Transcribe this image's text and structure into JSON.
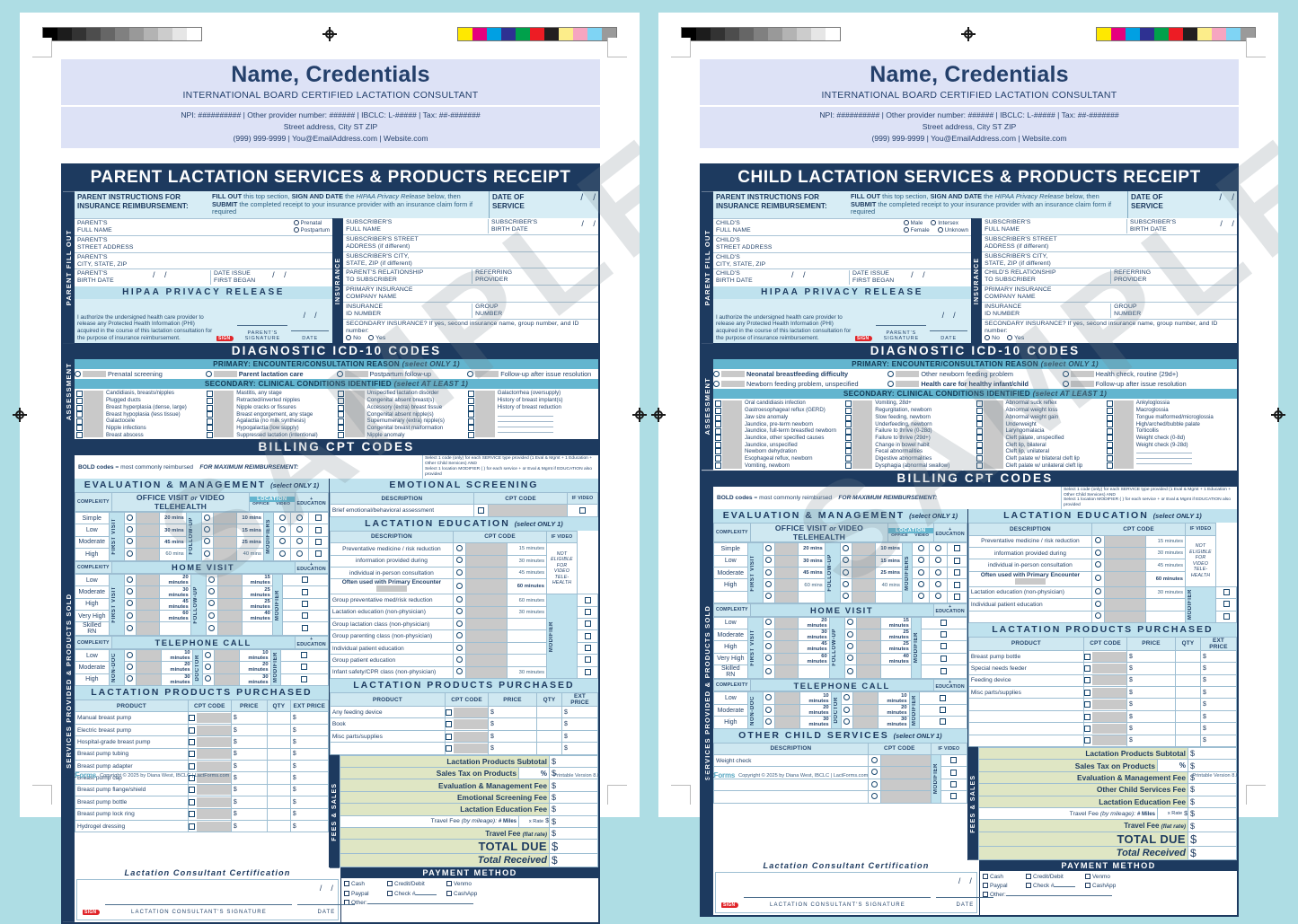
{
  "letterhead": {
    "name": "Name, Credentials",
    "subtitle": "INTERNATIONAL BOARD CERTIFIED LACTATION CONSULTANT",
    "line1": "NPI: ########## | Other provider number: ###### | IBCLC: L-##### | Tax: ##-#######",
    "line2": "Street address, City ST ZIP",
    "line3": "(999) 999-9999 | You@EmailAddress.com | Website.com"
  },
  "watermark": "SAMPLE",
  "common": {
    "tab_fillout": "PARENT FILL OUT",
    "tab_insurance": "INSURANCE",
    "tab_assessment": "ASSESSMENT",
    "tab_services": "SERVICES PROVIDED & PRODUCTS SOLD",
    "tab_fees": "FEES & SALES",
    "instructions_label": "PARENT INSTRUCTIONS FOR INSURANCE REIMBURSEMENT:",
    "instructions_text_a": "FILL OUT",
    "instructions_text_b": " this top section, ",
    "instructions_text_c": "SIGN AND DATE",
    "instructions_text_d": " the ",
    "instructions_text_e": "HIPAA Privacy Release",
    "instructions_text_f": " below, then ",
    "instructions_text_g": "SUBMIT",
    "instructions_text_h": " the completed receipt to your insurance provider with an insurance claim form if required",
    "date_of_service": "DATE OF SERVICE",
    "subscriber_full_name": "SUBSCRIBER'S FULL NAME",
    "subscriber_birth_date": "SUBSCRIBER'S BIRTH DATE",
    "subscriber_street": "SUBSCRIBER'S STREET ADDRESS (if different)",
    "subscriber_city": "SUBSCRIBER'S CITY, STATE, ZIP (if different)",
    "referring_provider": "REFERRING PROVIDER",
    "primary_insurance": "PRIMARY INSURANCE COMPANY NAME",
    "insurance_id": "INSURANCE ID NUMBER",
    "group_number": "GROUP NUMBER",
    "secondary_insurance": "SECONDARY INSURANCE?  If yes, second insurance name, group number, and ID number:",
    "opt_no": "No",
    "opt_yes": "Yes",
    "hipaa_title": "HIPAA PRIVACY RELEASE",
    "hipaa_text": "I authorize the undersigned health care provider to release any Protected Health Information (PHI) acquired in the course of this lactation consultation for the purpose of insurance reimbursement.",
    "sign_badge": "SIGN",
    "parents_signature": "PARENT'S SIGNATURE",
    "date_label": "DATE",
    "date_issue_first_began": "DATE ISSUE FIRST BEGAN",
    "icd_title": "DIAGNOSTIC ICD-10 CODES",
    "primary_banner": "PRIMARY:  ENCOUNTER/CONSULTATION REASON",
    "primary_banner_note": "(select ONLY 1)",
    "secondary_banner": "SECONDARY:  CLINICAL CONDITIONS IDENTIFIED",
    "secondary_banner_note": "(select AT LEAST 1)",
    "billing_title": "BILLING CPT CODES",
    "bold_note_a": "BOLD codes",
    "bold_note_b": " = most commonly reimbursed",
    "bold_note_c": "FOR MAXIMUM REIMBURSEMENT:",
    "eval_mgmt": "EVALUATION & MANAGEMENT",
    "select_only_1": "(select ONLY 1)",
    "complexity": "COMPLEXITY",
    "office_visit_a": "OFFICE VISIT",
    "office_visit_or": "or",
    "office_visit_b": "VIDEO TELEHEALTH",
    "location": "LOCATION",
    "loc_office": "OFFICE",
    "loc_video": "VIDEO",
    "plus_education": "+ EDUCATION",
    "first_visit": "FIRST VISIT",
    "follow_up": "FOLLOW-UP",
    "modifiers": "MODIFIERS",
    "modifier": "MODIFIER",
    "home_visit": "HOME VISIT",
    "telephone_call": "TELEPHONE CALL",
    "non_doc": "NON-DOC",
    "doctor": "DOCTOR",
    "lactation_education": "LACTATION EDUCATION",
    "lactation_products": "LACTATION PRODUCTS PURCHASED",
    "col_description": "DESCRIPTION",
    "col_cpt_code": "CPT CODE",
    "col_if_video": "IF VIDEO",
    "col_product": "PRODUCT",
    "col_price": "PRICE",
    "col_qty": "QTY",
    "col_ext_price": "EXT PRICE",
    "not_eligible": "NOT ELIGIBLE FOR VIDEO TELE-HEALTH",
    "edu_desc_1": "Preventative medicine / risk reduction",
    "edu_desc_2": "information provided during",
    "edu_desc_3": "individual in-person consultation",
    "edu_desc_4": "Often used with Primary Encounter",
    "cert_title": "Lactation Consultant Certification",
    "cert_sig_label": "LACTATION CONSULTANT'S SIGNATURE",
    "payment_method": "PAYMENT METHOD",
    "pay_options": [
      "Cash",
      "Credit/Debit",
      "Venmo",
      "Paypal",
      "Check #",
      "CashApp",
      "Other:"
    ],
    "totals": {
      "subtotal": "Lactation Products Subtotal",
      "sales_tax": "Sales Tax on Products",
      "pct": "%",
      "eval_fee": "Evaluation & Management Fee",
      "lactation_edu_fee": "Lactation Education Fee",
      "travel_mileage_a": "Travel Fee",
      "travel_mileage_b": "(by mileage):",
      "travel_miles": "# Miles",
      "travel_rate": "x Rate",
      "travel_flat_a": "Travel Fee",
      "travel_flat_b": "(flat rate)",
      "total_due": "TOTAL DUE",
      "total_received": "Total Received",
      "dollar": "$"
    },
    "footer_copyright": "Copyright © 2025 by Diana West, IBCLC  |  LactForms.com",
    "footer_version": "Printable Version 8.0",
    "logo_a": "Lact",
    "logo_b": "Forms",
    "max_reimb_note_1": "Select 1 code (only) for each SERVICE type provided (1 Eval & Mgmt + 1 Education + Other Child Services) AND",
    "max_reimb_note_2": "Select 1 location MODIFIER (              ) for each service +         or Eval & Mgmt if EDUCATION also provided"
  },
  "left_form": {
    "title": "PARENT LACTATION SERVICES & PRODUCTS RECEIPT",
    "fields": {
      "full_name": "PARENT'S FULL NAME",
      "street": "PARENT'S STREET ADDRESS",
      "city": "PARENT'S CITY, STATE, ZIP",
      "birth_date": "PARENT'S BIRTH DATE",
      "relationship": "PARENT'S RELATIONSHIP TO SUBSCRIBER"
    },
    "status_options": [
      "Prenatal",
      "Postpartum"
    ],
    "icd_primary": [
      "Prenatal screening",
      "Parent lactation care",
      "Postpartum follow-up",
      "Follow-up after issue resolution"
    ],
    "icd_primary_bold": [
      false,
      true,
      false,
      false
    ],
    "icd_secondary": [
      [
        "Candidiasis, breasts/nipples",
        "Plugged ducts",
        "Breast hyperplasia (dense, large)",
        "Breast hypoplasia (less tissue)",
        "Galactocele",
        "Nipple infections",
        "Breast abscess"
      ],
      [
        "Mastitis, any stage",
        "Retracted/inverted nipples",
        "Nipple cracks or fissures",
        "Breast engorgement, any stage",
        "Agalactia (no milk synthesis)",
        "Hypogalactia (low supply)",
        "Suppressed lactation (intentional)"
      ],
      [
        "Unspecified lactation disorder",
        "Congenital absent breast(s)",
        "Accessory (extra) breast tissue",
        "Congenital absent nipple(s)",
        "Supernumerary (extra) nipple(s)",
        "Congenital breast malformation",
        "Nipple anomaly"
      ],
      [
        "Galactorrhea (oversupply)",
        "History of breast implant(s)",
        "History of breast reduction",
        "",
        "",
        "",
        ""
      ]
    ],
    "office_rows": [
      {
        "complexity": "Simple",
        "first_mins": "20 mins",
        "follow_mins": "10 mins",
        "bold": true
      },
      {
        "complexity": "Low",
        "first_mins": "30 mins",
        "follow_mins": "15 mins",
        "bold": true
      },
      {
        "complexity": "Moderate",
        "first_mins": "45 mins",
        "follow_mins": "25 mins",
        "bold": true
      },
      {
        "complexity": "High",
        "first_mins": "60 mins",
        "follow_mins": "40 mins",
        "bold": false
      }
    ],
    "home_rows": [
      {
        "complexity": "Low",
        "first_mins": "20 minutes",
        "follow_mins": "15 minutes"
      },
      {
        "complexity": "Moderate",
        "first_mins": "30 minutes",
        "follow_mins": "25 minutes"
      },
      {
        "complexity": "High",
        "first_mins": "45 minutes",
        "follow_mins": "25 minutes"
      },
      {
        "complexity": "Very High",
        "first_mins": "60 minutes",
        "follow_mins": "40 minutes"
      },
      {
        "complexity": "Skilled RN",
        "first_mins": "",
        "follow_mins": ""
      }
    ],
    "phone_rows": [
      {
        "complexity": "Low",
        "first_mins": "10 minutes",
        "follow_mins": "10 minutes"
      },
      {
        "complexity": "Moderate",
        "first_mins": "20 minutes",
        "follow_mins": "20 minutes"
      },
      {
        "complexity": "High",
        "first_mins": "30 minutes",
        "follow_mins": "30 minutes"
      }
    ],
    "emotional_screening_title": "EMOTIONAL SCREENING",
    "emotional_row": "Brief emotional/behavioral assessment",
    "education_rows": [
      {
        "label": "Group preventative med/risk reduction",
        "mins": "60 minutes"
      },
      {
        "label": "Lactation education (non-physician)",
        "mins": "30 minutes"
      },
      {
        "label": "Group lactation class (non-physician)",
        "mins": ""
      },
      {
        "label": "Group parenting class (non-physician)",
        "mins": ""
      },
      {
        "label": "Individual patient education",
        "mins": ""
      },
      {
        "label": "Group patient education",
        "mins": ""
      },
      {
        "label": "Infant safety/CPR class (non-physician)",
        "mins": "30 minutes"
      }
    ],
    "education_primary_mins": [
      "15 minutes",
      "30 minutes",
      "45 minutes",
      "60 minutes"
    ],
    "products_left": [
      "Manual breast pump",
      "Electric breast pump",
      "Hospital-grade breast pump",
      "Breast pump tubing",
      "Breast pump adapter",
      "Breast pump cap",
      "Breast pump flange/shield",
      "Breast pump bottle",
      "Breast pump lock ring",
      "Hydrogel dressing"
    ],
    "products_right": [
      "Any feeding device",
      "Book",
      "Misc parts/supplies",
      ""
    ],
    "fee_rows": [
      "Lactation Products Subtotal",
      "Sales Tax on Products",
      "Evaluation & Management Fee",
      "Emotional Screening Fee",
      "Lactation Education Fee"
    ]
  },
  "right_form": {
    "title": "CHILD LACTATION SERVICES & PRODUCTS RECEIPT",
    "fields": {
      "full_name": "CHILD'S FULL NAME",
      "street": "CHILD'S STREET ADDRESS",
      "city": "CHILD'S CITY, STATE, ZIP",
      "birth_date": "CHILD'S BIRTH DATE",
      "relationship": "CHILD'S RELATIONSHIP TO SUBSCRIBER"
    },
    "sex_options": [
      "Male",
      "Intersex",
      "Female",
      "Unknown"
    ],
    "icd_primary": [
      "Neonatal breastfeeding difficulty",
      "Newborn feeding problem, unspecified",
      "Other newborn feeding problem",
      "Health care for healthy infant/child",
      "Health check, routine (29d+)",
      "Follow-up after issue resolution"
    ],
    "icd_primary_bold": [
      true,
      false,
      false,
      true,
      false,
      false
    ],
    "icd_secondary": [
      [
        "Oral candidiasis infection",
        "Gastroesophageal reflux (GERD)",
        "Jaw size anomaly",
        "Jaundice, pre-term newborn",
        "Jaundice, full-term breastfed newborn",
        "Jaundice, other specified causes",
        "Jaundice, unspecified",
        "Newborn dehydration",
        "Esophageal reflux, newborn",
        "Vomiting, newborn"
      ],
      [
        "Vomiting, 28d+",
        "Regurgitation, newborn",
        "Slow feeding, newborn",
        "Underfeeding, newborn",
        "Failure to thrive (0-28d)",
        "Failure to thrive (29d+)",
        "Change in bowel habit",
        "Fecal abnormalities",
        "Digestive abnormalities",
        "Dysphagia (abnormal swallow)"
      ],
      [
        "Abnormal suck reflex",
        "Abnormal weight loss",
        "Abnormal weight gain",
        "Underweight",
        "Laryngomalacia",
        "Cleft palate, unspecified",
        "Cleft lip, bilateral",
        "Cleft lip, unilateral",
        "Cleft palate w/ bilateral cleft lip",
        "Cleft palate w/ unilateral cleft lip"
      ],
      [
        "Ankyloglossia",
        "Macroglossia",
        "Tongue malformed/microglossia",
        "High/arched/bubble palate",
        "Torticollis",
        "Weight check (0-8d)",
        "Weight check (9-28d)",
        "",
        "",
        ""
      ]
    ],
    "office_rows": [
      {
        "complexity": "Simple",
        "first_mins": "20 mins",
        "follow_mins": "10 mins",
        "bold": true
      },
      {
        "complexity": "Low",
        "first_mins": "30 mins",
        "follow_mins": "15 mins",
        "bold": true
      },
      {
        "complexity": "Moderate",
        "first_mins": "45 mins",
        "follow_mins": "25 mins",
        "bold": true
      },
      {
        "complexity": "High",
        "first_mins": "60 mins",
        "follow_mins": "40 mins",
        "bold": false
      },
      {
        "complexity": "",
        "first_mins": "",
        "follow_mins": "",
        "bold": false
      }
    ],
    "home_rows": [
      {
        "complexity": "Low",
        "first_mins": "20 minutes",
        "follow_mins": "15 minutes"
      },
      {
        "complexity": "Moderate",
        "first_mins": "30 minutes",
        "follow_mins": "25 minutes"
      },
      {
        "complexity": "High",
        "first_mins": "45 minutes",
        "follow_mins": "25 minutes"
      },
      {
        "complexity": "Very High",
        "first_mins": "60 minutes",
        "follow_mins": "40 minutes"
      },
      {
        "complexity": "Skilled RN",
        "first_mins": "",
        "follow_mins": ""
      }
    ],
    "phone_rows": [
      {
        "complexity": "Low",
        "first_mins": "10 minutes",
        "follow_mins": "10 minutes"
      },
      {
        "complexity": "Moderate",
        "first_mins": "20 minutes",
        "follow_mins": "20 minutes"
      },
      {
        "complexity": "High",
        "first_mins": "30 minutes",
        "follow_mins": "30 minutes"
      }
    ],
    "education_rows": [
      {
        "label": "Lactation education (non-physician)",
        "mins": "30 minutes"
      },
      {
        "label": "Individual patient education",
        "mins": ""
      },
      {
        "label": "",
        "mins": ""
      }
    ],
    "education_primary_mins": [
      "15 minutes",
      "30 minutes",
      "45 minutes",
      "60 minutes"
    ],
    "other_child_services_title": "OTHER CHILD SERVICES",
    "other_child_rows": [
      "Weight check",
      "",
      "",
      ""
    ],
    "products": [
      "Breast pump bottle",
      "Special needs feeder",
      "Feeding device",
      "Misc parts/supplies",
      "",
      "",
      "",
      ""
    ],
    "fee_rows": [
      "Lactation Products Subtotal",
      "Sales Tax on Products",
      "Evaluation & Management Fee",
      "Other Child Services Fee",
      "Lactation Education Fee"
    ]
  },
  "colorbar": {
    "grays": [
      "#000000",
      "#1c1c1c",
      "#333333",
      "#4d4d4d",
      "#666666",
      "#808080",
      "#999999",
      "#b3b3b3",
      "#cccccc",
      "#e6e6e6",
      "#ffffff"
    ],
    "colors": [
      "#ffe800",
      "#e6007e",
      "#00a0e3",
      "#2e3192",
      "#00a14b",
      "#ed1c24",
      "#231f20",
      "#fced8a",
      "#f6a5c0",
      "#7fd4f4",
      "#9a9a9a"
    ]
  }
}
